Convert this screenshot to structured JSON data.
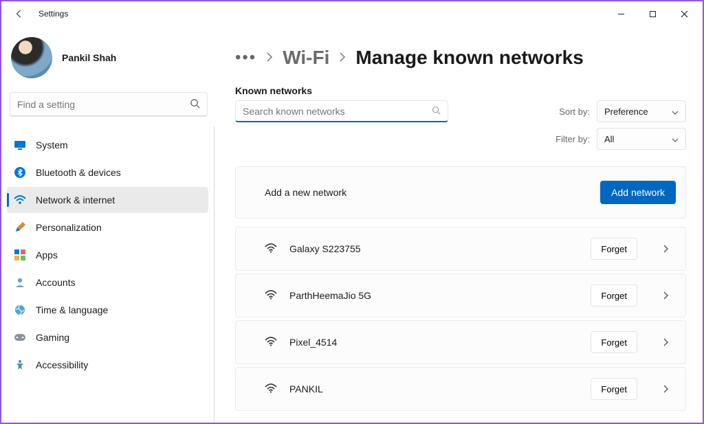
{
  "window": {
    "title": "Settings"
  },
  "user": {
    "name": "Pankil Shah"
  },
  "sidebarSearch": {
    "placeholder": "Find a setting"
  },
  "nav": {
    "items": [
      {
        "label": "System"
      },
      {
        "label": "Bluetooth & devices"
      },
      {
        "label": "Network & internet"
      },
      {
        "label": "Personalization"
      },
      {
        "label": "Apps"
      },
      {
        "label": "Accounts"
      },
      {
        "label": "Time & language"
      },
      {
        "label": "Gaming"
      },
      {
        "label": "Accessibility"
      }
    ],
    "selectedIndex": 2
  },
  "breadcrumb": {
    "parent": "Wi-Fi",
    "current": "Manage known networks"
  },
  "knownNetworks": {
    "title": "Known networks",
    "searchPlaceholder": "Search known networks",
    "sortByLabel": "Sort by:",
    "sortByValue": "Preference",
    "filterByLabel": "Filter by:",
    "filterByValue": "All",
    "addCard": {
      "label": "Add a new network",
      "button": "Add network"
    },
    "forgetLabel": "Forget",
    "networks": [
      {
        "name": "Galaxy S223755"
      },
      {
        "name": "ParthHeemaJio 5G"
      },
      {
        "name": "Pixel_4514"
      },
      {
        "name": "PANKIL"
      }
    ]
  }
}
